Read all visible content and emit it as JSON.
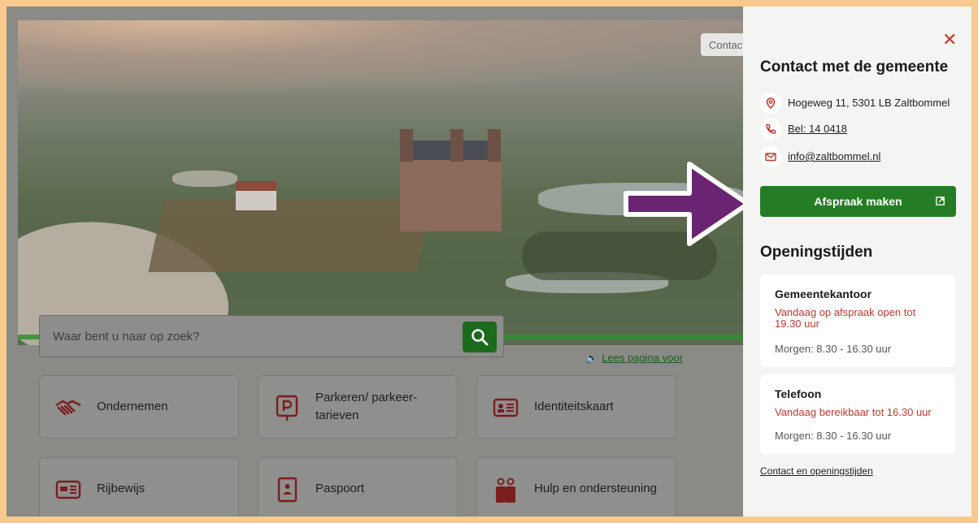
{
  "search": {
    "placeholder": "Waar bent u naar op zoek?"
  },
  "listen": {
    "label": "Lees pagina voor"
  },
  "contact_tab": {
    "label": "Contact"
  },
  "tiles": [
    {
      "label": "Ondernemen",
      "icon": "handshake-icon"
    },
    {
      "label": "Parkeren/ parkeer-tarieven",
      "line1": "Parkeren/ parkeer-",
      "line2": "tarieven",
      "icon": "parking-icon"
    },
    {
      "label": "Identiteitskaart",
      "icon": "id-card-icon"
    },
    {
      "label": "Rijbewijs",
      "icon": "drivers-license-icon"
    },
    {
      "label": "Paspoort",
      "icon": "passport-icon"
    },
    {
      "label": "Hulp en ondersteuning",
      "icon": "people-support-icon"
    }
  ],
  "panel": {
    "close_icon": "close-icon",
    "title": "Contact met de gemeente",
    "address": "Hogeweg 11, 5301 LB Zaltbommel",
    "phone": "Bel: 14 0418",
    "email": "info@zaltbommel.nl",
    "appointment_button": "Afspraak maken",
    "opening_title": "Openingstijden",
    "cards": [
      {
        "name": "Gemeentekantoor",
        "status": "Vandaag op afspraak open tot 19.30 uur",
        "tomorrow": "Morgen: 8.30 - 16.30 uur"
      },
      {
        "name": "Telefoon",
        "status": "Vandaag bereikbaar tot 16.30 uur",
        "tomorrow": "Morgen: 8.30 - 16.30 uur"
      }
    ],
    "footer_link": "Contact en openingstijden"
  },
  "colors": {
    "frame_border": "#f7c98f",
    "primary_green": "#247d24",
    "status_red": "#c0392b",
    "arrow_purple": "#6b2374"
  }
}
